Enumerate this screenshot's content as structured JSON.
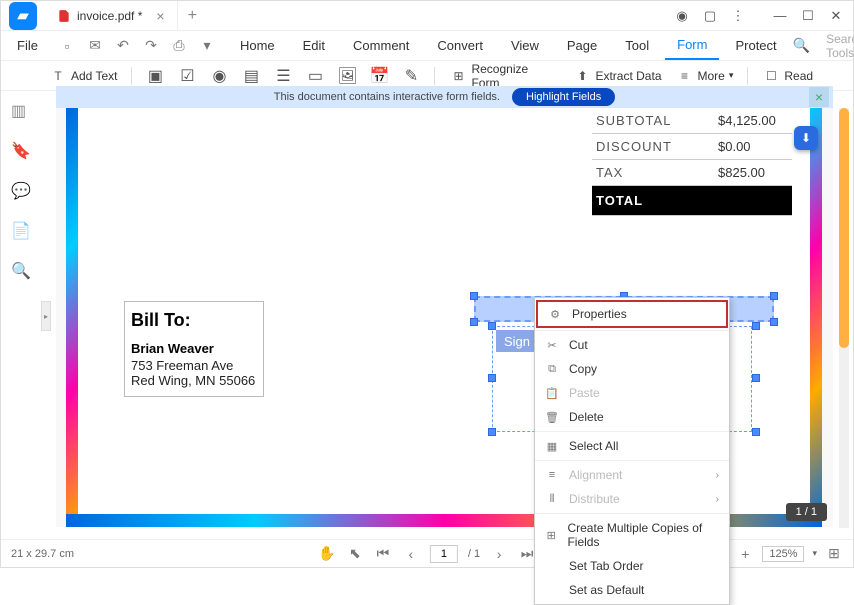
{
  "titlebar": {
    "tab_name": "invoice.pdf *"
  },
  "menubar": {
    "file": "File",
    "items": [
      "Home",
      "Edit",
      "Comment",
      "Convert",
      "View",
      "Page",
      "Tool",
      "Form",
      "Protect"
    ],
    "active": "Form",
    "search_placeholder": "Search Tools"
  },
  "toolbar": {
    "add_text": "Add Text",
    "recognize_form": "Recognize Form",
    "extract_data": "Extract Data",
    "more": "More",
    "read": "Read"
  },
  "banner": {
    "message": "This document contains interactive form fields.",
    "button": "Highlight Fields"
  },
  "totals": {
    "subtotal_label": "SUBTOTAL",
    "subtotal_value": "$4,125.00",
    "discount_label": "DISCOUNT",
    "discount_value": "$0.00",
    "tax_label": "TAX",
    "tax_value": "$825.00",
    "total_label": "TOTAL",
    "total_value": ""
  },
  "billto": {
    "heading": "Bill To:",
    "name": "Brian Weaver",
    "addr1": "753 Freeman Ave",
    "addr2": "Red Wing, MN 55066"
  },
  "sign_label": "Sign He",
  "context_menu": {
    "properties": "Properties",
    "cut": "Cut",
    "copy": "Copy",
    "paste": "Paste",
    "delete": "Delete",
    "select_all": "Select All",
    "alignment": "Alignment",
    "distribute": "Distribute",
    "create_copies": "Create Multiple Copies of Fields",
    "set_tab_order": "Set Tab Order",
    "set_default": "Set as Default"
  },
  "page_indicator": "1 / 1",
  "statusbar": {
    "dims": "21 x 29.7 cm",
    "page_current": "1",
    "page_total": "/ 1",
    "zoom": "125%"
  }
}
